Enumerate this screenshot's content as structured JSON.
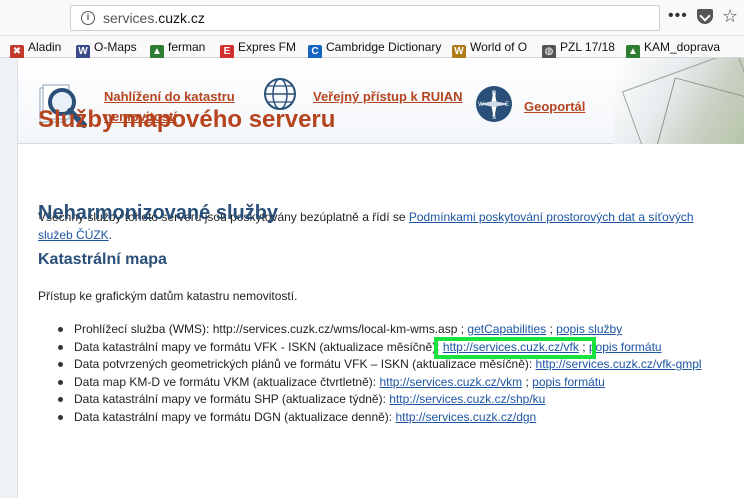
{
  "browser": {
    "url_prefix": "services.",
    "url_domain": "cuzk.cz",
    "bookmarks": [
      {
        "label": "Aladin",
        "color": "#c0392b",
        "glyph": "✖"
      },
      {
        "label": "O-Maps",
        "color": "#3a4a8a",
        "glyph": "W"
      },
      {
        "label": "ferman",
        "color": "#2e7d32",
        "glyph": "▲"
      },
      {
        "label": "Expres FM",
        "color": "#d32f2f",
        "glyph": "E"
      },
      {
        "label": "Cambridge Dictionary",
        "color": "#1565c0",
        "glyph": "C"
      },
      {
        "label": "World of O",
        "color": "#b07a1a",
        "glyph": "W"
      },
      {
        "label": "PZL 17/18",
        "color": "#555555",
        "glyph": "◍"
      },
      {
        "label": "KAM_doprava",
        "color": "#2e7d32",
        "glyph": "▲"
      }
    ]
  },
  "header": {
    "link1_line1": "Nahlížení do katastru",
    "link1_line2": "nemovitostí",
    "link2": "Veřejný přístup k RUIAN",
    "link3": "Geoportál",
    "compass_letters": [
      "N",
      "E",
      "S",
      "W"
    ]
  },
  "page": {
    "title": "Služby mapového serveru",
    "intro_text": "Všechny služby tohoto serveru jsou poskytovány bezúplatně a řídí se ",
    "intro_link": "Podmínkami poskytování prostorových dat a síťových služeb ČÚZK",
    "intro_end": ".",
    "section_title": "Neharmonizované služby",
    "subsection_title": "Katastrální mapa",
    "access_text": "Přístup ke grafickým datům katastru nemovitostí.",
    "services": [
      {
        "text": "Prohlížecí služba (WMS): http://services.cuzk.cz/wms/local-km-wms.asp ; ",
        "links": [
          "getCapabilities",
          "popis služby"
        ]
      },
      {
        "text": "Data katastrální mapy ve formátu VFK - ISKN (aktualizace měsíčně): ",
        "links": [
          "http://services.cuzk.cz/vfk",
          "popis formátu"
        ]
      },
      {
        "text": "Data potvrzených geometrických plánů ve formátu VFK – ISKN (aktualizace měsíčně): ",
        "links": [
          "http://services.cuzk.cz/vfk-gmpl"
        ]
      },
      {
        "text": "Data map KM-D ve formátu VKM (aktualizace čtvrtletně): ",
        "links": [
          "http://services.cuzk.cz/vkm",
          "popis formátu"
        ]
      },
      {
        "text": "Data katastrální mapy ve formátu SHP (aktualizace týdně): ",
        "links": [
          "http://services.cuzk.cz/shp/ku"
        ]
      },
      {
        "text": "Data katastrální mapy ve formátu DGN (aktualizace denně): ",
        "links": [
          "http://services.cuzk.cz/dgn"
        ]
      }
    ]
  }
}
